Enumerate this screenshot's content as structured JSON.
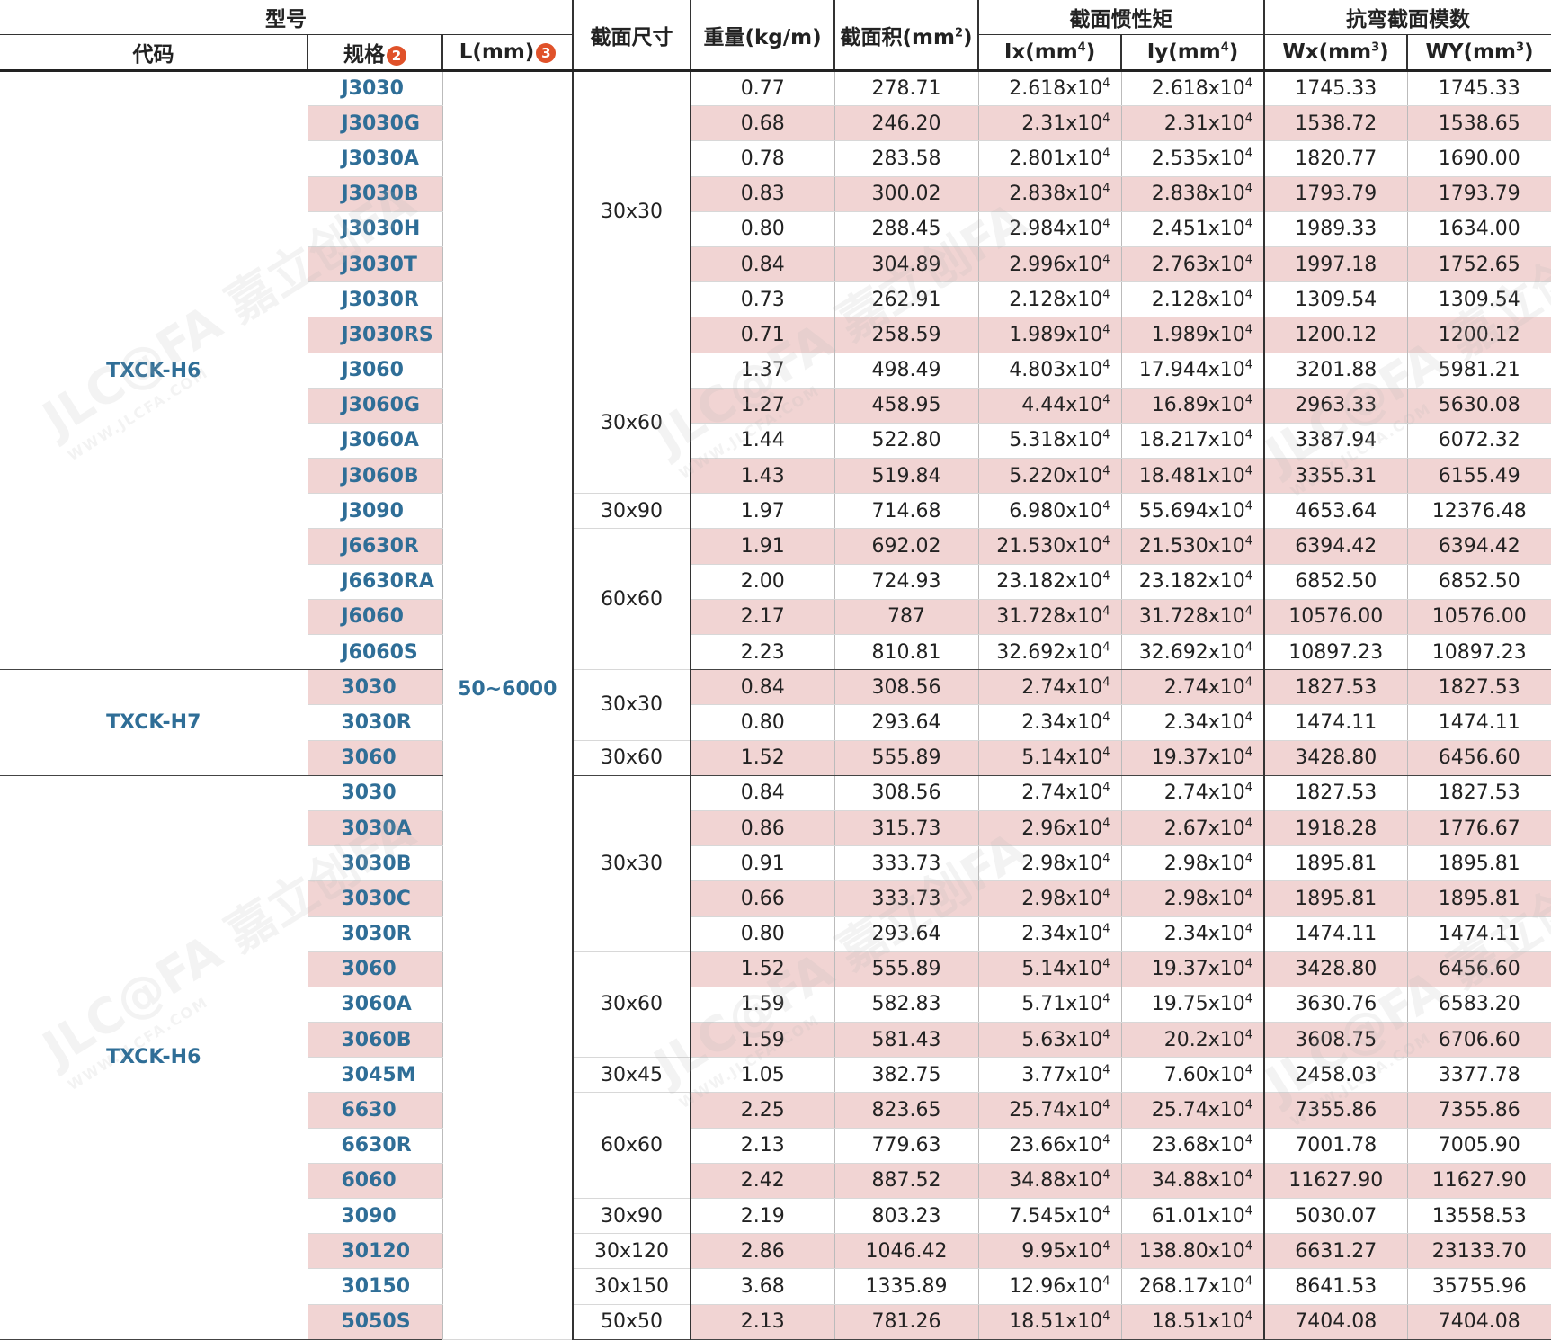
{
  "header": {
    "model": "型号",
    "section_size": "截面尺寸",
    "weight": "重量(kg/m)",
    "area": "截面积(mm",
    "area_sup": "2",
    "area_close": ")",
    "inertia": "截面惯性矩",
    "modulus": "抗弯截面模数",
    "code": "代码",
    "spec": "规格",
    "spec_badge": "2",
    "length": "L(mm)",
    "length_badge": "3",
    "ix": "Ix(mm",
    "ix_sup": "4",
    "ix_close": ")",
    "iy": "Iy(mm",
    "iy_sup": "4",
    "iy_close": ")",
    "wx": "Wx(mm",
    "wx_sup": "3",
    "wx_close": ")",
    "wy": "WY(mm",
    "wy_sup": "3",
    "wy_close": ")"
  },
  "exp_suffix": "x10",
  "exp_sup": "4",
  "length_value": "50~6000",
  "watermark": {
    "brand": "JLC@FA 嘉立创FA",
    "url": "WWW.JLCFA.COM"
  },
  "groups": [
    {
      "code": "TXCK-H6",
      "sizes": [
        {
          "size": "30x30",
          "rows": [
            {
              "spec": "J3030",
              "weight": "0.77",
              "area": "278.71",
              "ix": "2.618",
              "iy": "2.618",
              "wx": "1745.33",
              "wy": "1745.33"
            },
            {
              "spec": "J3030G",
              "weight": "0.68",
              "area": "246.20",
              "ix": "2.31",
              "iy": "2.31",
              "wx": "1538.72",
              "wy": "1538.65"
            },
            {
              "spec": "J3030A",
              "weight": "0.78",
              "area": "283.58",
              "ix": "2.801",
              "iy": "2.535",
              "wx": "1820.77",
              "wy": "1690.00"
            },
            {
              "spec": "J3030B",
              "weight": "0.83",
              "area": "300.02",
              "ix": "2.838",
              "iy": "2.838",
              "wx": "1793.79",
              "wy": "1793.79"
            },
            {
              "spec": "J3030H",
              "weight": "0.80",
              "area": "288.45",
              "ix": "2.984",
              "iy": "2.451",
              "wx": "1989.33",
              "wy": "1634.00"
            },
            {
              "spec": "J3030T",
              "weight": "0.84",
              "area": "304.89",
              "ix": "2.996",
              "iy": "2.763",
              "wx": "1997.18",
              "wy": "1752.65"
            },
            {
              "spec": "J3030R",
              "weight": "0.73",
              "area": "262.91",
              "ix": "2.128",
              "iy": "2.128",
              "wx": "1309.54",
              "wy": "1309.54"
            },
            {
              "spec": "J3030RS",
              "weight": "0.71",
              "area": "258.59",
              "ix": "1.989",
              "iy": "1.989",
              "wx": "1200.12",
              "wy": "1200.12"
            }
          ]
        },
        {
          "size": "30x60",
          "rows": [
            {
              "spec": "J3060",
              "weight": "1.37",
              "area": "498.49",
              "ix": "4.803",
              "iy": "17.944",
              "wx": "3201.88",
              "wy": "5981.21"
            },
            {
              "spec": "J3060G",
              "weight": "1.27",
              "area": "458.95",
              "ix": "4.44",
              "iy": "16.89",
              "wx": "2963.33",
              "wy": "5630.08"
            },
            {
              "spec": "J3060A",
              "weight": "1.44",
              "area": "522.80",
              "ix": "5.318",
              "iy": "18.217",
              "wx": "3387.94",
              "wy": "6072.32"
            },
            {
              "spec": "J3060B",
              "weight": "1.43",
              "area": "519.84",
              "ix": "5.220",
              "iy": "18.481",
              "wx": "3355.31",
              "wy": "6155.49"
            }
          ]
        },
        {
          "size": "30x90",
          "rows": [
            {
              "spec": "J3090",
              "weight": "1.97",
              "area": "714.68",
              "ix": "6.980",
              "iy": "55.694",
              "wx": "4653.64",
              "wy": "12376.48"
            }
          ]
        },
        {
          "size": "60x60",
          "rows": [
            {
              "spec": "J6630R",
              "weight": "1.91",
              "area": "692.02",
              "ix": "21.530",
              "iy": "21.530",
              "wx": "6394.42",
              "wy": "6394.42"
            },
            {
              "spec": "J6630RA",
              "weight": "2.00",
              "area": "724.93",
              "ix": "23.182",
              "iy": "23.182",
              "wx": "6852.50",
              "wy": "6852.50"
            },
            {
              "spec": "J6060",
              "weight": "2.17",
              "area": "787",
              "ix": "31.728",
              "iy": "31.728",
              "wx": "10576.00",
              "wy": "10576.00"
            },
            {
              "spec": "J6060S",
              "weight": "2.23",
              "area": "810.81",
              "ix": "32.692",
              "iy": "32.692",
              "wx": "10897.23",
              "wy": "10897.23"
            }
          ]
        }
      ]
    },
    {
      "code": "TXCK-H7",
      "sizes": [
        {
          "size": "30x30",
          "rows": [
            {
              "spec": "3030",
              "weight": "0.84",
              "area": "308.56",
              "ix": "2.74",
              "iy": "2.74",
              "wx": "1827.53",
              "wy": "1827.53"
            },
            {
              "spec": "3030R",
              "weight": "0.80",
              "area": "293.64",
              "ix": "2.34",
              "iy": "2.34",
              "wx": "1474.11",
              "wy": "1474.11"
            }
          ]
        },
        {
          "size": "30x60",
          "rows": [
            {
              "spec": "3060",
              "weight": "1.52",
              "area": "555.89",
              "ix": "5.14",
              "iy": "19.37",
              "wx": "3428.80",
              "wy": "6456.60"
            }
          ]
        }
      ]
    },
    {
      "code": "TXCK-H6",
      "sizes": [
        {
          "size": "30x30",
          "rows": [
            {
              "spec": "3030",
              "weight": "0.84",
              "area": "308.56",
              "ix": "2.74",
              "iy": "2.74",
              "wx": "1827.53",
              "wy": "1827.53"
            },
            {
              "spec": "3030A",
              "weight": "0.86",
              "area": "315.73",
              "ix": "2.96",
              "iy": "2.67",
              "wx": "1918.28",
              "wy": "1776.67"
            },
            {
              "spec": "3030B",
              "weight": "0.91",
              "area": "333.73",
              "ix": "2.98",
              "iy": "2.98",
              "wx": "1895.81",
              "wy": "1895.81"
            },
            {
              "spec": "3030C",
              "weight": "0.66",
              "area": "333.73",
              "ix": "2.98",
              "iy": "2.98",
              "wx": "1895.81",
              "wy": "1895.81"
            },
            {
              "spec": "3030R",
              "weight": "0.80",
              "area": "293.64",
              "ix": "2.34",
              "iy": "2.34",
              "wx": "1474.11",
              "wy": "1474.11"
            }
          ]
        },
        {
          "size": "30x60",
          "rows": [
            {
              "spec": "3060",
              "weight": "1.52",
              "area": "555.89",
              "ix": "5.14",
              "iy": "19.37",
              "wx": "3428.80",
              "wy": "6456.60"
            },
            {
              "spec": "3060A",
              "weight": "1.59",
              "area": "582.83",
              "ix": "5.71",
              "iy": "19.75",
              "wx": "3630.76",
              "wy": "6583.20"
            },
            {
              "spec": "3060B",
              "weight": "1.59",
              "area": "581.43",
              "ix": "5.63",
              "iy": "20.2",
              "wx": "3608.75",
              "wy": "6706.60"
            }
          ]
        },
        {
          "size": "30x45",
          "rows": [
            {
              "spec": "3045M",
              "weight": "1.05",
              "area": "382.75",
              "ix": "3.77",
              "iy": "7.60",
              "wx": "2458.03",
              "wy": "3377.78"
            }
          ]
        },
        {
          "size": "60x60",
          "rows": [
            {
              "spec": "6630",
              "weight": "2.25",
              "area": "823.65",
              "ix": "25.74",
              "iy": "25.74",
              "wx": "7355.86",
              "wy": "7355.86"
            },
            {
              "spec": "6630R",
              "weight": "2.13",
              "area": "779.63",
              "ix": "23.66",
              "iy": "23.68",
              "wx": "7001.78",
              "wy": "7005.90"
            },
            {
              "spec": "6060",
              "weight": "2.42",
              "area": "887.52",
              "ix": "34.88",
              "iy": "34.88",
              "wx": "11627.90",
              "wy": "11627.90"
            }
          ]
        },
        {
          "size": "30x90",
          "rows": [
            {
              "spec": "3090",
              "weight": "2.19",
              "area": "803.23",
              "ix": "7.545",
              "iy": "61.01",
              "wx": "5030.07",
              "wy": "13558.53"
            }
          ]
        },
        {
          "size": "30x120",
          "rows": [
            {
              "spec": "30120",
              "weight": "2.86",
              "area": "1046.42",
              "ix": "9.95",
              "iy": "138.80",
              "wx": "6631.27",
              "wy": "23133.70"
            }
          ]
        },
        {
          "size": "30x150",
          "rows": [
            {
              "spec": "30150",
              "weight": "3.68",
              "area": "1335.89",
              "ix": "12.96",
              "iy": "268.17",
              "wx": "8641.53",
              "wy": "35755.96"
            }
          ]
        },
        {
          "size": "50x50",
          "rows": [
            {
              "spec": "5050S",
              "weight": "2.13",
              "area": "781.26",
              "ix": "18.51",
              "iy": "18.51",
              "wx": "7404.08",
              "wy": "7404.08"
            }
          ]
        }
      ]
    }
  ]
}
